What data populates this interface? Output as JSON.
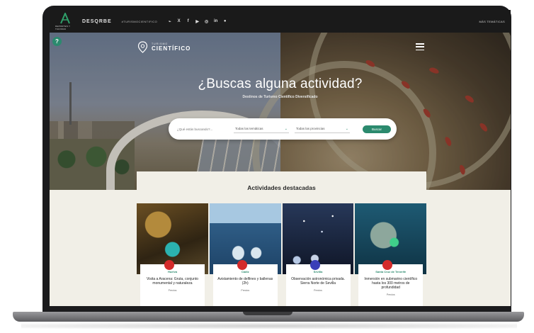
{
  "topbar": {
    "logo_small_text": "DEPORTES Y TURISMO",
    "second_logo": "DESQRBE",
    "hashtag": "#TURISMOCIENTIFICO",
    "socials": [
      "rss",
      "x",
      "facebook",
      "youtube",
      "instagram",
      "linkedin",
      "spotify"
    ],
    "right_menu": "MÁS TEMÁTICAS"
  },
  "brand": {
    "small": "TURISMO",
    "big": "CIENTÍFICO"
  },
  "hero": {
    "headline": "¿Buscas alguna actividad?",
    "subline": "Destinos de Turismo Científico Diversificado"
  },
  "search": {
    "placeholder": "¿Qué estás buscando?...",
    "filter_theme": "Todas las temáticas",
    "filter_province": "Todas las provincias",
    "button": "Buscar"
  },
  "featured": {
    "title": "Actividades destacadas",
    "cards": [
      {
        "place": "Huelva",
        "title": "Visita a Aracena: Gruta, conjunto monumental y naturaleza",
        "meta": "Precios"
      },
      {
        "place": "Cádiz",
        "title": "Avistamiento de delfines y ballenas (2h)",
        "meta": "Precios"
      },
      {
        "place": "Sevilla",
        "title": "Observación astronómica privada. Sierra Norte de Sevilla",
        "meta": "Precios"
      },
      {
        "place": "Santa Cruz de Tenerife",
        "title": "Inmersión en submarino científico hasta los 300 metros de profundidad",
        "meta": "Precios"
      }
    ]
  },
  "colors": {
    "accent": "#2b8a6e",
    "topbar": "#1a1a1a",
    "marker_red": "#d42b2b",
    "marker_blue": "#3a3fb8"
  },
  "icons": {
    "help": "question-icon",
    "brand": "map-pin-icon",
    "menu": "hamburger-icon"
  }
}
